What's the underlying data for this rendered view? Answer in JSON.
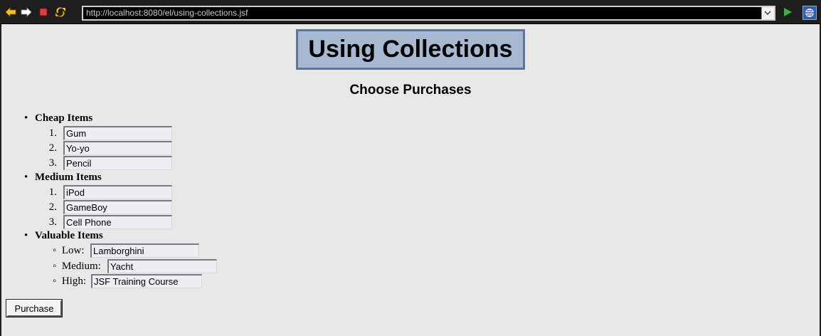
{
  "browser": {
    "url": "http://localhost:8080/el/using-collections.jsf"
  },
  "page": {
    "title": "Using Collections",
    "subtitle": "Choose Purchases",
    "purchase_button": "Purchase"
  },
  "categories": {
    "cheap": {
      "label": "Cheap Items",
      "items": [
        {
          "number": "1.",
          "value": "Gum"
        },
        {
          "number": "2.",
          "value": "Yo-yo"
        },
        {
          "number": "3.",
          "value": "Pencil"
        }
      ]
    },
    "medium": {
      "label": "Medium Items",
      "items": [
        {
          "number": "1.",
          "value": "iPod"
        },
        {
          "number": "2.",
          "value": "GameBoy"
        },
        {
          "number": "3.",
          "value": "Cell Phone"
        }
      ]
    },
    "valuable": {
      "label": "Valuable Items",
      "items": [
        {
          "label": "Low:",
          "value": "Lamborghini"
        },
        {
          "label": "Medium:",
          "value": "Yacht"
        },
        {
          "label": "High:",
          "value": "JSF Training Course"
        }
      ]
    }
  },
  "colors": {
    "page_background": "#e8e8e8",
    "title_background": "#a6b9d0",
    "title_border": "#5e7696",
    "toolbar": "#1e1e1e"
  }
}
